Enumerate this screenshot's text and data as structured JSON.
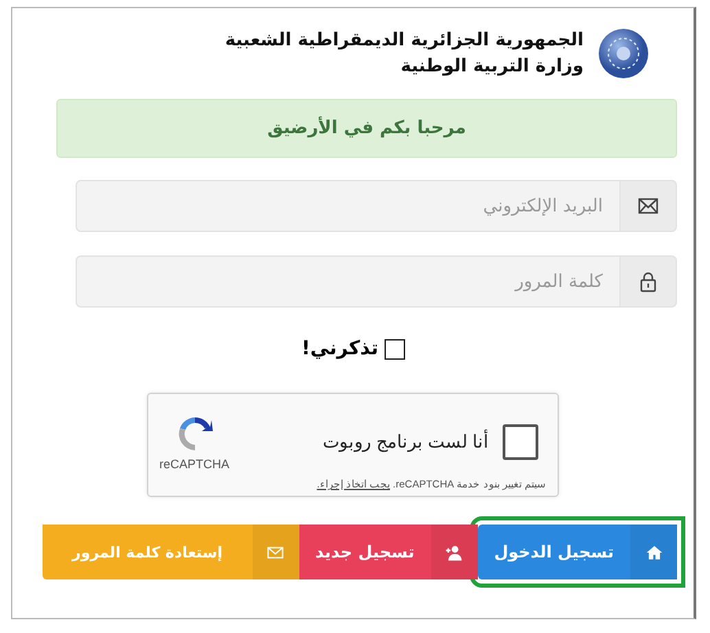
{
  "header": {
    "lines": [
      "الجمهورية الجزائرية الديمقراطية الشعبية",
      "وزارة التربية الوطنية"
    ]
  },
  "alert": {
    "text": "مرحبا بكم في الأرضيق"
  },
  "fields": [
    {
      "kind": "email",
      "placeholder": "البريد الإلكتروني"
    },
    {
      "kind": "password",
      "placeholder": "كلمة المرور"
    }
  ],
  "remember": {
    "label": "تذكرني!",
    "checked": false
  },
  "captcha": {
    "label": "أنا لست برنامج روبوت",
    "checked": false,
    "brand": "reCAPTCHA",
    "notice": "سيتم تغيير بنود خدمة reCAPTCHA.",
    "notice_link": "يجب اتخاذ إجراء."
  },
  "buttons": [
    {
      "kind": "login",
      "label": "تسجيل الدخول",
      "highlighted": true
    },
    {
      "kind": "register",
      "label": "تسجيل جديد",
      "highlighted": false
    },
    {
      "kind": "recover",
      "label": "إستعادة كلمة المرور",
      "highlighted": false
    }
  ]
}
